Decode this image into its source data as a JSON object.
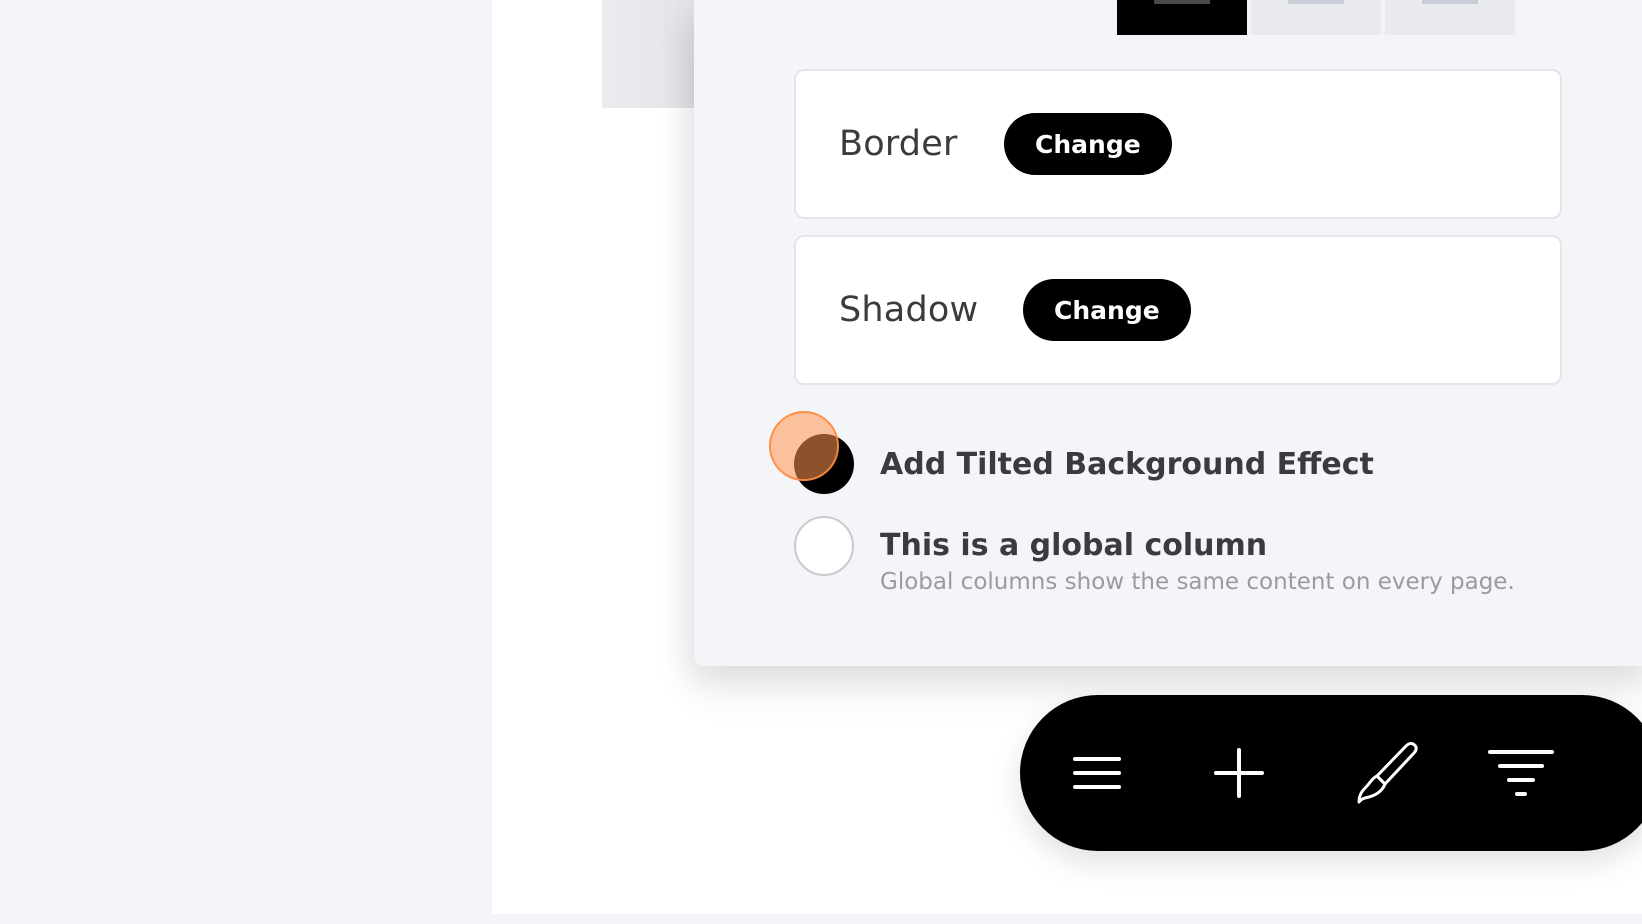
{
  "panel": {
    "border": {
      "label": "Border",
      "button": "Change"
    },
    "shadow": {
      "label": "Shadow",
      "button": "Change"
    }
  },
  "options": [
    {
      "label": "Add Tilted Background Effect",
      "checked": true
    },
    {
      "label": "This is a global column",
      "description": "Global columns show the same content on every page.",
      "checked": false
    }
  ],
  "toolbar": {
    "icons": [
      "menu-icon",
      "plus-icon",
      "paintbrush-icon",
      "filter-icon"
    ]
  },
  "colors": {
    "accent": "#000000",
    "click_indicator": "#ffa060"
  }
}
